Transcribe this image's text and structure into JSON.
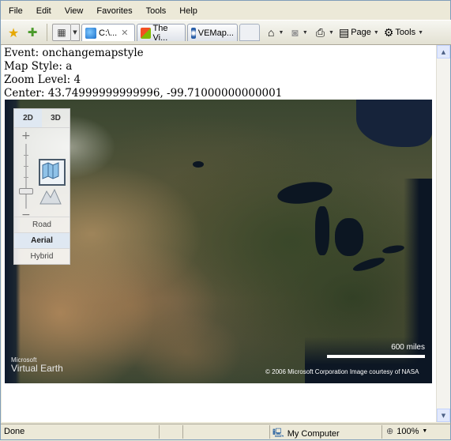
{
  "menu": [
    "File",
    "Edit",
    "View",
    "Favorites",
    "Tools",
    "Help"
  ],
  "tabs": [
    {
      "label": "C:\\...",
      "icon": "ie-icon",
      "active": true
    },
    {
      "label": "The Vi...",
      "icon": "msn-icon",
      "active": false
    },
    {
      "label": "VEMap...",
      "icon": "ve-icon",
      "active": false
    }
  ],
  "commands": {
    "page": "Page",
    "tools": "Tools"
  },
  "event_info": {
    "event": "Event: onchangemapstyle",
    "style": "Map Style: a",
    "zoom": "Zoom Level: 4",
    "center": "Center: 43.74999999999996, -99.71000000000001"
  },
  "map": {
    "dim_tabs": [
      "2D",
      "3D"
    ],
    "active_dim": "2D",
    "styles": [
      "Road",
      "Aerial",
      "Hybrid"
    ],
    "active_style": "Aerial",
    "logo_top": "Microsoft",
    "logo_bottom": "Virtual Earth",
    "scale_label": "600 miles",
    "copyright": "© 2006 Microsoft Corporation  Image courtesy of NASA"
  },
  "status": {
    "text": "Done",
    "zone": "My Computer",
    "zoom": "100%"
  }
}
